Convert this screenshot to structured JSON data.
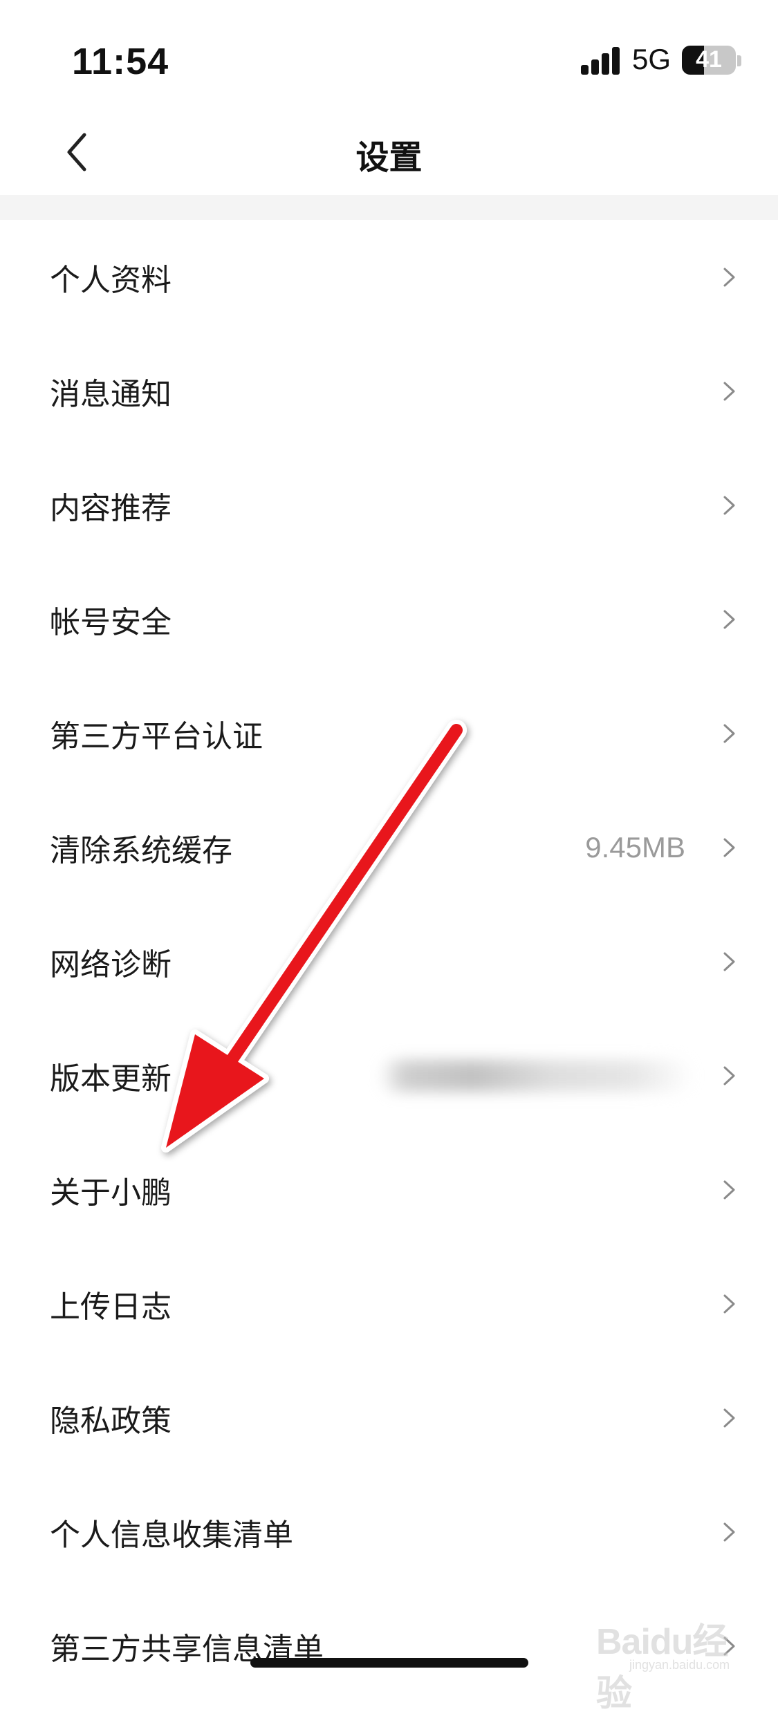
{
  "status_bar": {
    "time": "11:54",
    "network": "5G",
    "battery": "41",
    "battery_level": 0.41
  },
  "nav": {
    "title": "设置",
    "back_icon": "chevron-left-icon"
  },
  "settings": {
    "items": [
      {
        "label": "个人资料",
        "value": ""
      },
      {
        "label": "消息通知",
        "value": ""
      },
      {
        "label": "内容推荐",
        "value": ""
      },
      {
        "label": "帐号安全",
        "value": ""
      },
      {
        "label": "第三方平台认证",
        "value": ""
      },
      {
        "label": "清除系统缓存",
        "value": "9.45MB"
      },
      {
        "label": "网络诊断",
        "value": ""
      },
      {
        "label": "版本更新",
        "value": ""
      },
      {
        "label": "关于小鹏",
        "value": ""
      },
      {
        "label": "上传日志",
        "value": ""
      },
      {
        "label": "隐私政策",
        "value": ""
      },
      {
        "label": "个人信息收集清单",
        "value": ""
      },
      {
        "label": "第三方共享信息清单",
        "value": ""
      }
    ]
  },
  "annotation": {
    "arrow_color": "#e8141a",
    "arrow_icon": "red-arrow-annotation"
  },
  "watermark": {
    "brand": "Baidu经验",
    "url": "jingyan.baidu.com"
  },
  "colors": {
    "background": "#ffffff",
    "divider": "#f4f4f4",
    "value_text": "#9a9a9a"
  }
}
